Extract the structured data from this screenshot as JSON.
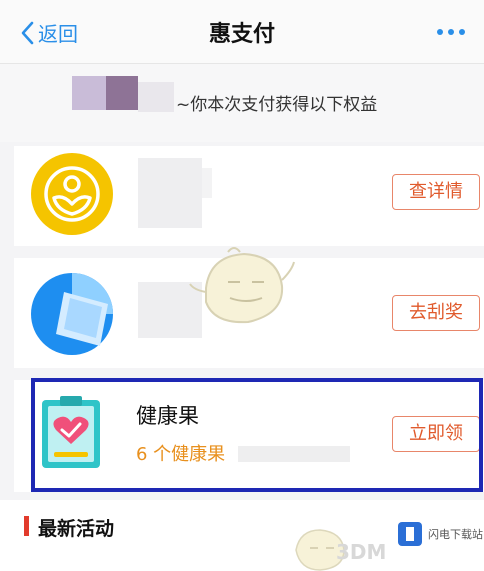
{
  "nav": {
    "back_label": "返回",
    "title": "惠支付"
  },
  "header": {
    "text": "~你本次支付获得以下权益"
  },
  "benefits": [
    {
      "button": "查详情",
      "icon": "gold-coin-icon"
    },
    {
      "button": "去刮奖",
      "icon": "blue-scratch-card-icon"
    },
    {
      "title": "健康果",
      "count": "6 个健康果",
      "button": "立即领",
      "icon": "health-clipboard-heart-icon"
    }
  ],
  "section": {
    "title": "最新活动"
  },
  "watermark": {
    "site": "3DM",
    "logo_text": "闪电下载站"
  },
  "colors": {
    "accent_blue": "#2a8fe8",
    "button_orange": "#e05a2c",
    "count_orange": "#e8901e",
    "highlight_border": "#1e28b4",
    "section_bar": "#e23b2c"
  }
}
